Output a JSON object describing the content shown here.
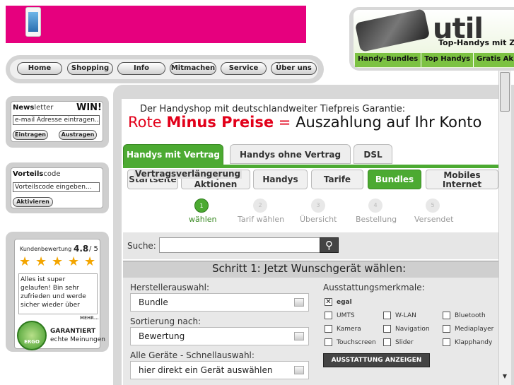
{
  "nav": {
    "items": [
      "Home",
      "Shopping",
      "Info",
      "Mitmachen",
      "Service",
      "Über uns"
    ]
  },
  "promo": {
    "logo": "util",
    "tagline": "Top-Handys mit Z",
    "links": [
      "Handy-Bundles",
      "Top Handys",
      "Gratis Ak"
    ]
  },
  "newsletter": {
    "title_bold": "News",
    "title_light": "letter",
    "win": "WIN!",
    "input_value": "e-mail Adresse eintragen...",
    "btn_subscribe": "Eintragen",
    "btn_unsubscribe": "Austragen"
  },
  "voucher": {
    "title_bold": "Vorteils",
    "title_light": "code",
    "input_value": "Vorteilscode eingeben...",
    "btn_activate": "Aktivieren"
  },
  "rating": {
    "label": "Kundenbewertung",
    "score": "4.8",
    "max": "/ 5",
    "stars": 5,
    "review": "Alles ist super gelaufen! Bin sehr zufrieden und werde sicher wieder über",
    "more": "MEHR...",
    "seal_text": "ERGO",
    "guaranteed": "GARANTIERT",
    "real_opinions": "echte Meinungen"
  },
  "main": {
    "tagline": "Der Handyshop mit deutschlandweiter Tiefpreis Garantie:",
    "headline_1": "Rote",
    "headline_2": "Minus Preise",
    "headline_3": "=",
    "headline_4": "Auszahlung auf Ihr Konto",
    "tabs": [
      "Handys mit Vertrag",
      "Handys ohne Vertrag",
      "DSL"
    ],
    "subtabs": {
      "overlay": "Vertragsverlängerung",
      "start": "Startseite",
      "top": "Top-\nAktionen",
      "handys": "Handys",
      "tarife": "Tarife",
      "bundles": "Bundles",
      "mobile": "Mobiles\nInternet"
    },
    "steps": [
      {
        "num": "1",
        "label": "wählen"
      },
      {
        "num": "2",
        "label": "Tarif wählen"
      },
      {
        "num": "3",
        "label": "Übersicht"
      },
      {
        "num": "4",
        "label": "Bestellung"
      },
      {
        "num": "5",
        "label": "Versendet"
      }
    ],
    "search_label": "Suche:",
    "step_title": "Schritt 1: Jetzt Wunschgerät wählen:",
    "manufacturer_label": "Herstellerauswahl:",
    "manufacturer_value": "Bundle",
    "sort_label": "Sortierung nach:",
    "sort_value": "Bewertung",
    "quick_label": "Alle Geräte - Schnellauswahl:",
    "quick_value": "hier direkt ein Gerät auswählen",
    "features_title": "Ausstattungsmerkmale:",
    "feature_egal": "egal",
    "features": [
      "UMTS",
      "W-LAN",
      "Bluetooth",
      "Kamera",
      "Navigation",
      "Mediaplayer",
      "Touchscreen",
      "Slider",
      "Klapphandy"
    ],
    "features_button": "AUSSTATTUNG ANZEIGEN"
  },
  "colors": {
    "magenta": "#e6007e",
    "green": "#4caa32",
    "red": "#e2001a"
  }
}
